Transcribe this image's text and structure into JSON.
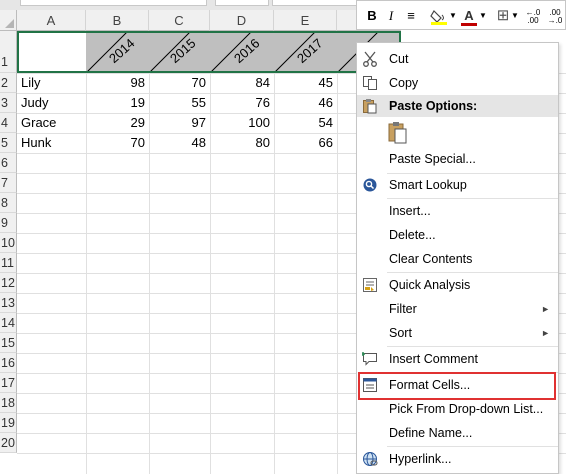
{
  "columns": [
    "A",
    "B",
    "C",
    "D",
    "E"
  ],
  "rows": [
    "1",
    "2",
    "3",
    "4",
    "5",
    "6",
    "7",
    "8",
    "9",
    "10",
    "11",
    "12",
    "13",
    "14",
    "15",
    "16",
    "17",
    "18",
    "19",
    "20"
  ],
  "header_years": [
    "2014",
    "2015",
    "2016",
    "2017"
  ],
  "table": [
    {
      "name": "Lily",
      "v": [
        "98",
        "70",
        "84",
        "45"
      ]
    },
    {
      "name": "Judy",
      "v": [
        "19",
        "55",
        "76",
        "46"
      ]
    },
    {
      "name": "Grace",
      "v": [
        "29",
        "97",
        "100",
        "54"
      ]
    },
    {
      "name": "Hunk",
      "v": [
        "70",
        "48",
        "80",
        "66"
      ]
    }
  ],
  "toolbar": {
    "bold": "B",
    "italic": "I",
    "align": "≡",
    "font_color": "A",
    "borders": "⊞",
    "inc_decimal": "←.0\n.00",
    "dec_decimal": ".00\n→.0"
  },
  "menu": {
    "cut": "Cut",
    "copy": "Copy",
    "paste_options": "Paste Options:",
    "paste_special": "Paste Special...",
    "smart_lookup": "Smart Lookup",
    "insert": "Insert...",
    "delete": "Delete...",
    "clear_contents": "Clear Contents",
    "quick_analysis": "Quick Analysis",
    "filter": "Filter",
    "sort": "Sort",
    "insert_comment": "Insert Comment",
    "format_cells": "Format Cells...",
    "pick_from_list": "Pick From Drop-down List...",
    "define_name": "Define Name...",
    "hyperlink": "Hyperlink..."
  },
  "colors": {
    "selection": "#217346",
    "highlight_box": "#e03131",
    "header_fill": "#bfbfbf",
    "font_color_bar": "#c00000",
    "fill_color_bar": "#ffff00"
  }
}
